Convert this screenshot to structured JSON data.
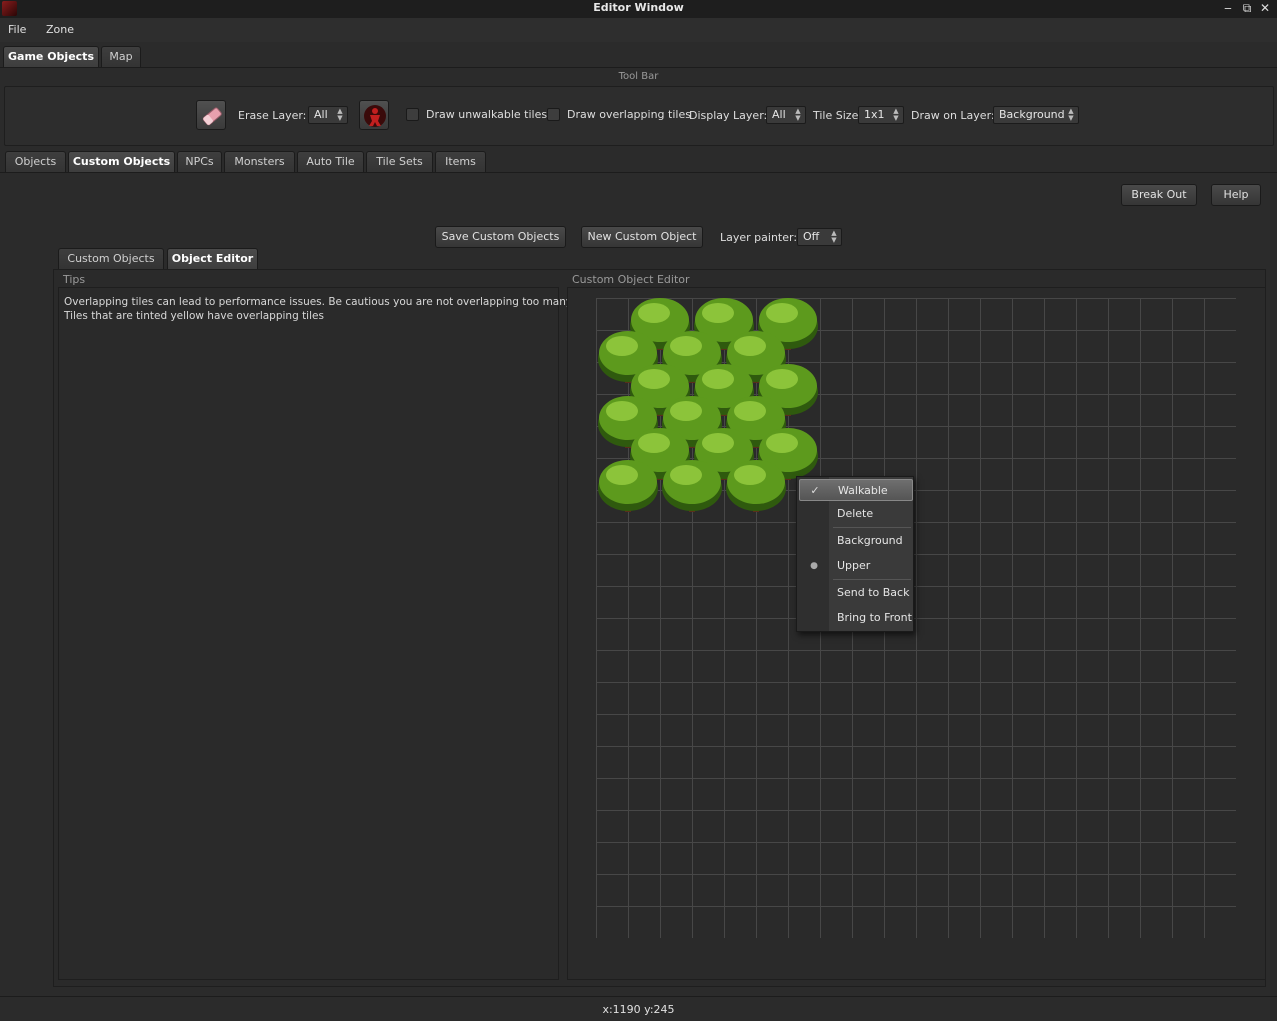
{
  "window": {
    "title": "Editor Window",
    "controls": {
      "minimize": "‒",
      "restore": "⧉",
      "close": "✕"
    }
  },
  "menubar": {
    "items": [
      "File",
      "Zone"
    ]
  },
  "top_tabs": {
    "items": [
      "Game Objects",
      "Map"
    ],
    "active": "Game Objects"
  },
  "toolbar": {
    "label": "Tool Bar",
    "erase_layer_label": "Erase Layer:",
    "erase_layer_value": "All",
    "draw_unwalkable_label": "Draw unwalkable tiles",
    "draw_unwalkable_checked": false,
    "draw_overlapping_label": "Draw overlapping tiles",
    "draw_overlapping_checked": false,
    "display_layer_label": "Display Layer:",
    "display_layer_value": "All",
    "tile_size_label": "Tile Size",
    "tile_size_value": "1x1",
    "draw_on_layer_label": "Draw on Layer:",
    "draw_on_layer_value": "Background",
    "icons": {
      "eraser": "eraser-icon",
      "walk": "character-icon"
    }
  },
  "object_tabs": {
    "items": [
      "Objects",
      "Custom Objects",
      "NPCs",
      "Monsters",
      "Auto Tile",
      "Tile Sets",
      "Items"
    ],
    "active": "Custom Objects"
  },
  "actions": {
    "break_out": "Break Out",
    "help": "Help",
    "save_custom_objects": "Save Custom Objects",
    "new_custom_object": "New Custom Object",
    "layer_painter_label": "Layer painter:",
    "layer_painter_value": "Off"
  },
  "sub_tabs": {
    "items": [
      "Custom Objects",
      "Object Editor"
    ],
    "active": "Object Editor"
  },
  "tips": {
    "label": "Tips",
    "line1": "Overlapping tiles can lead to performance issues. Be cautious you are not overlapping too many tiles.",
    "line2": "Tiles that are tinted yellow have overlapping tiles"
  },
  "editor": {
    "label": "Custom Object Editor",
    "grid_columns": 20,
    "grid_rows": 20
  },
  "context_menu": {
    "items": {
      "walkable": "Walkable",
      "delete": "Delete",
      "background": "Background",
      "upper": "Upper",
      "send_to_back": "Send to Back",
      "bring_to_front": "Bring to Front"
    },
    "walkable_checked": true,
    "layer_selected": "Upper",
    "check_mark": "✓",
    "radio_mark": "●"
  },
  "status": {
    "coords": "x:1190 y:245"
  },
  "colors": {
    "background": "#2b2b2b",
    "panel": "#2a2a2a",
    "grid_line": "#474747",
    "tree_foliage": "#5d9a1d",
    "tree_trunk": "#5a2e1a"
  }
}
